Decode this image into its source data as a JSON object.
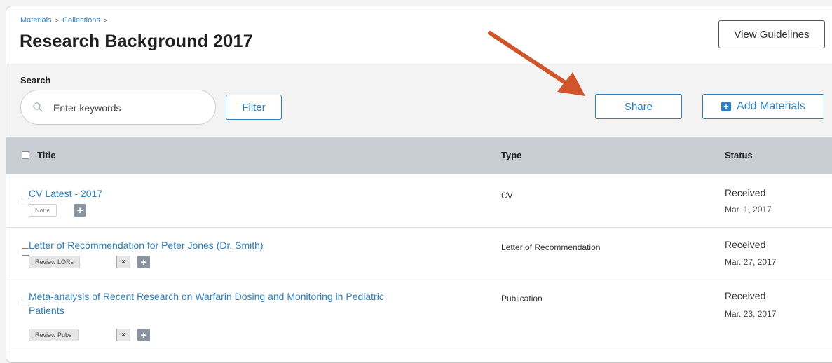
{
  "breadcrumb": {
    "items": [
      "Materials",
      "Collections"
    ],
    "sep": ">"
  },
  "page_title": "Research Background 2017",
  "header": {
    "guidelines_label": "View Guidelines"
  },
  "toolbar": {
    "search_label": "Search",
    "search_placeholder": "Enter keywords",
    "filter_label": "Filter",
    "share_label": "Share",
    "add_label": "Add Materials"
  },
  "table": {
    "columns": [
      "Title",
      "Type",
      "Status"
    ],
    "rows": [
      {
        "title": "CV Latest - 2017",
        "type": "CV",
        "status": "Received",
        "date": "Mar. 1, 2017",
        "tag": "None",
        "tag_removable": false
      },
      {
        "title": "Letter of Recommendation for Peter Jones (Dr. Smith)",
        "type": "Letter of Recommendation",
        "status": "Received",
        "date": "Mar. 27, 2017",
        "tag": "Review LORs",
        "tag_removable": true
      },
      {
        "title_line1": "Meta-analysis of Recent Research on Warfarin Dosing and Monitoring in Pediatric",
        "title_line2": "Patients",
        "type": "Publication",
        "status": "Received",
        "date": "Mar. 23, 2017",
        "tag": "Review Pubs",
        "tag_removable": true
      }
    ]
  },
  "icons": {
    "remove": "×",
    "add": "+"
  },
  "colors": {
    "accent": "#2e7fbf",
    "arrow": "#d0552a",
    "table_header": "#c9ced4"
  }
}
